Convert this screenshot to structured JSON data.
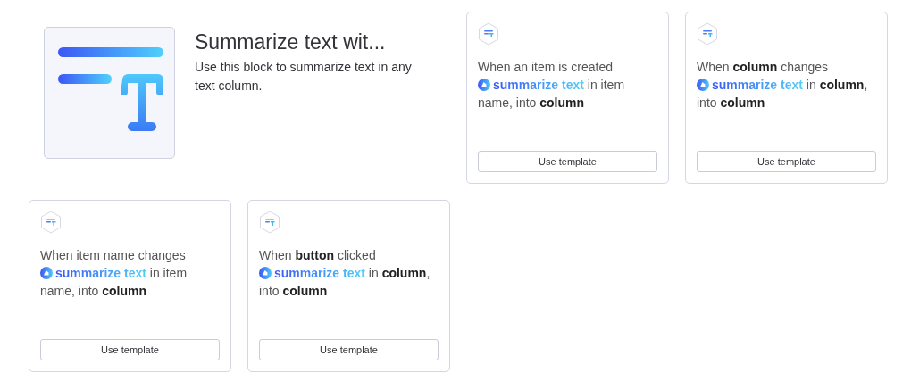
{
  "block": {
    "title": "Summarize text wit...",
    "description": "Use this block to summarize text in any text column."
  },
  "templates": [
    {
      "trigger": "When an item is created",
      "action": "summarize text",
      "detail": "in item name, into **column**",
      "button": "Use template"
    },
    {
      "trigger": "When **column** changes",
      "action": "summarize text",
      "detail": "in **column**, into **column**",
      "button": "Use template"
    },
    {
      "trigger": "When item name changes",
      "action": "summarize text",
      "detail": "in item name, into **column**",
      "button": "Use template"
    },
    {
      "trigger": "When **button** clicked",
      "action": "summarize text",
      "detail": "in **column**, into **column**",
      "button": "Use template"
    }
  ]
}
